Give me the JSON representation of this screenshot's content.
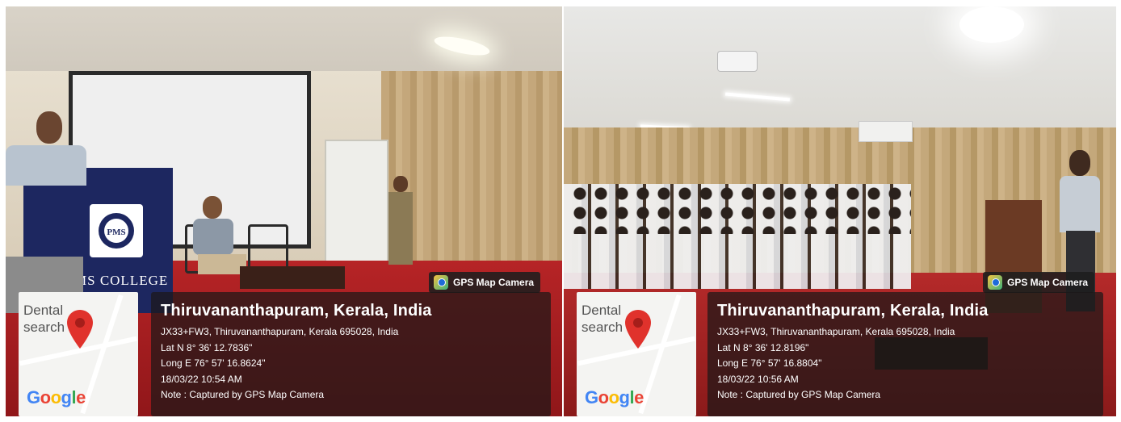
{
  "photos": [
    {
      "gps_badge": "GPS Map Camera",
      "map": {
        "label_line1": "Dental",
        "label_line2": "search",
        "logo": "Google"
      },
      "podium_text": "MS COLLEGE",
      "location": {
        "city": "Thiruvananthapuram, Kerala, India",
        "address": "JX33+FW3, Thiruvananthapuram, Kerala 695028, India",
        "lat": "Lat N 8° 36' 12.7836\"",
        "long": "Long E 76° 57' 16.8624\"",
        "datetime": "18/03/22 10:54 AM",
        "note": "Note : Captured by GPS Map Camera"
      }
    },
    {
      "gps_badge": "GPS Map Camera",
      "map": {
        "label_line1": "Dental",
        "label_line2": "search",
        "logo": "Google"
      },
      "location": {
        "city": "Thiruvananthapuram, Kerala, India",
        "address": "JX33+FW3, Thiruvananthapuram, Kerala 695028, India",
        "lat": "Lat N 8° 36' 12.8196\"",
        "long": "Long E 76° 57' 16.8804\"",
        "datetime": "18/03/22 10:56 AM",
        "note": "Note : Captured by GPS Map Camera"
      }
    }
  ],
  "colors": {
    "pin": "#e0322c",
    "panel": "#1c1818",
    "floor": "#b62426",
    "podium": "#1d2760"
  }
}
